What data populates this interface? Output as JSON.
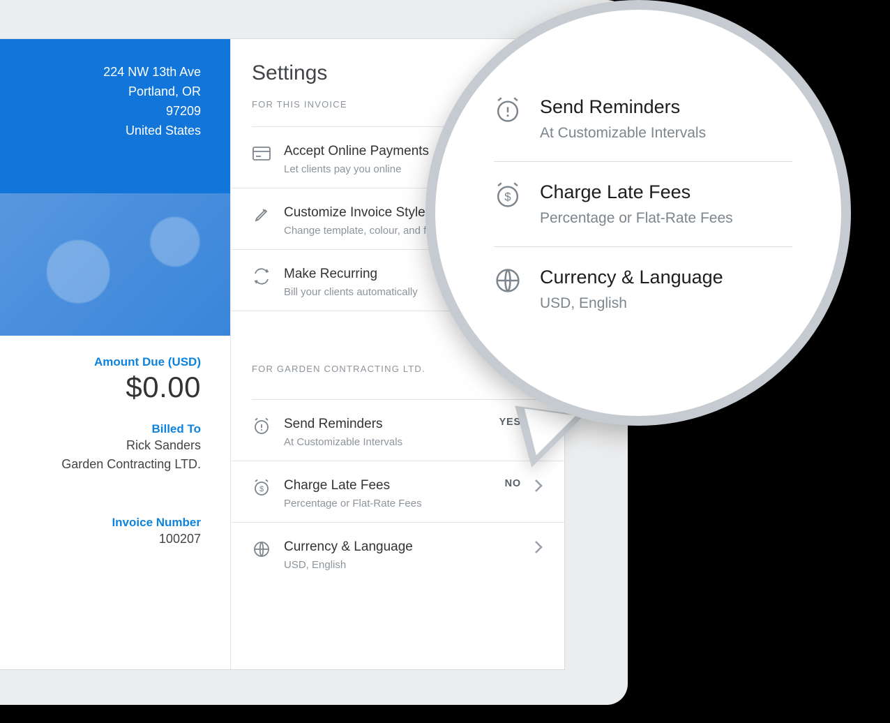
{
  "invoice": {
    "address_line1": "224 NW 13th Ave",
    "address_city": "Portland, OR",
    "address_zip": "97209",
    "address_country": "United States",
    "amount_due_label": "Amount Due (USD)",
    "amount_due_value": "$0.00",
    "billed_to_label": "Billed To",
    "billed_to_name": "Rick Sanders",
    "billed_to_company": "Garden Contracting LTD.",
    "invoice_number_label": "Invoice Number",
    "invoice_number_value": "100207"
  },
  "settings": {
    "title": "Settings",
    "for_invoice_caption": "FOR THIS INVOICE",
    "for_client_caption": "FOR GARDEN CONTRACTING LTD.",
    "yes_label": "YES",
    "no_label": "NO",
    "items_invoice": [
      {
        "title": "Accept Online Payments",
        "sub": "Let clients pay you online"
      },
      {
        "title": "Customize Invoice Style",
        "sub": "Change template, colour, and font"
      },
      {
        "title": "Make Recurring",
        "sub": "Bill your clients automatically"
      }
    ],
    "items_client": [
      {
        "title": "Send Reminders",
        "sub": "At Customizable Intervals",
        "value": "YES"
      },
      {
        "title": "Charge Late Fees",
        "sub": "Percentage or Flat-Rate Fees",
        "value": "NO"
      },
      {
        "title": "Currency & Language",
        "sub": "USD, English",
        "value": ""
      }
    ]
  },
  "callout": {
    "items": [
      {
        "title": "Send Reminders",
        "sub": "At Customizable Intervals"
      },
      {
        "title": "Charge Late Fees",
        "sub": "Percentage or Flat-Rate Fees"
      },
      {
        "title": "Currency & Language",
        "sub": "USD, English"
      }
    ]
  }
}
